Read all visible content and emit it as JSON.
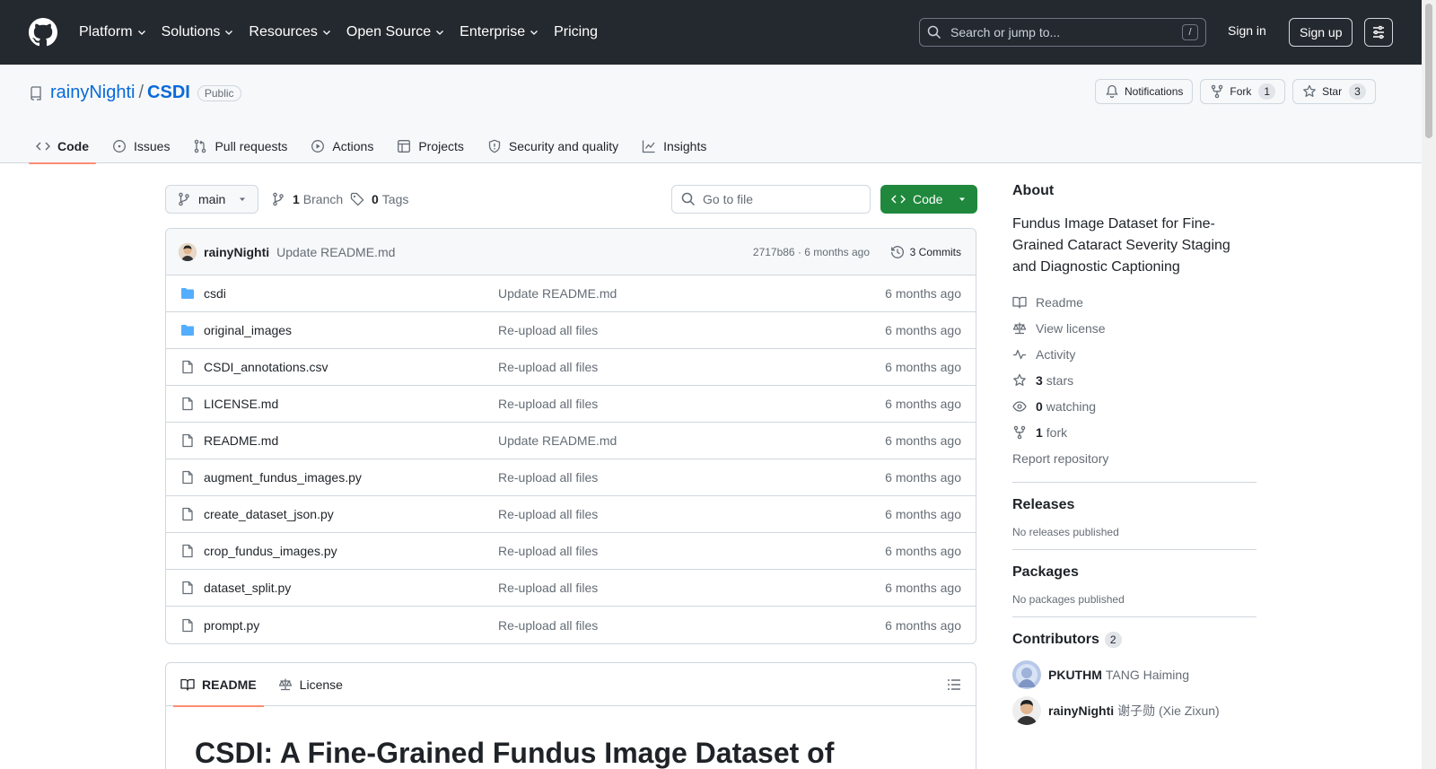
{
  "header": {
    "nav": [
      {
        "label": "Platform",
        "has_dropdown": true
      },
      {
        "label": "Solutions",
        "has_dropdown": true
      },
      {
        "label": "Resources",
        "has_dropdown": true
      },
      {
        "label": "Open Source",
        "has_dropdown": true
      },
      {
        "label": "Enterprise",
        "has_dropdown": true
      },
      {
        "label": "Pricing",
        "has_dropdown": false
      }
    ],
    "search_placeholder": "Search or jump to...",
    "search_shortcut": "/",
    "sign_in": "Sign in",
    "sign_up": "Sign up"
  },
  "repo": {
    "owner": "rainyNighti",
    "separator": "/",
    "name": "CSDI",
    "visibility": "Public",
    "notifications_label": "Notifications",
    "fork_label": "Fork",
    "fork_count": "1",
    "star_label": "Star",
    "star_count": "3",
    "tabs": [
      {
        "label": "Code",
        "icon": "code-icon",
        "active": true
      },
      {
        "label": "Issues",
        "icon": "issue-icon"
      },
      {
        "label": "Pull requests",
        "icon": "pull-request-icon"
      },
      {
        "label": "Actions",
        "icon": "play-icon"
      },
      {
        "label": "Projects",
        "icon": "table-icon"
      },
      {
        "label": "Security and quality",
        "icon": "shield-icon"
      },
      {
        "label": "Insights",
        "icon": "graph-icon"
      }
    ]
  },
  "toolbar": {
    "branch": "main",
    "branch_count": "1",
    "branch_label": "Branch",
    "tag_count": "0",
    "tag_label": "Tags",
    "goto_placeholder": "Go to file",
    "code_button": "Code"
  },
  "commit": {
    "author": "rainyNighti",
    "message": "Update README.md",
    "meta": "2717b86 · 6 months ago",
    "commits_label": "3 Commits"
  },
  "files": [
    {
      "name": "csdi",
      "type": "folder",
      "message": "Update README.md",
      "time": "6 months ago"
    },
    {
      "name": "original_images",
      "type": "folder",
      "message": "Re-upload all files",
      "time": "6 months ago"
    },
    {
      "name": "CSDI_annotations.csv",
      "type": "file",
      "message": "Re-upload all files",
      "time": "6 months ago"
    },
    {
      "name": "LICENSE.md",
      "type": "file",
      "message": "Re-upload all files",
      "time": "6 months ago"
    },
    {
      "name": "README.md",
      "type": "file",
      "message": "Update README.md",
      "time": "6 months ago"
    },
    {
      "name": "augment_fundus_images.py",
      "type": "file",
      "message": "Re-upload all files",
      "time": "6 months ago"
    },
    {
      "name": "create_dataset_json.py",
      "type": "file",
      "message": "Re-upload all files",
      "time": "6 months ago"
    },
    {
      "name": "crop_fundus_images.py",
      "type": "file",
      "message": "Re-upload all files",
      "time": "6 months ago"
    },
    {
      "name": "dataset_split.py",
      "type": "file",
      "message": "Re-upload all files",
      "time": "6 months ago"
    },
    {
      "name": "prompt.py",
      "type": "file",
      "message": "Re-upload all files",
      "time": "6 months ago"
    }
  ],
  "readme": {
    "tab_readme": "README",
    "tab_license": "License",
    "heading": "CSDI: A Fine-Grained Fundus Image Dataset of"
  },
  "about": {
    "title": "About",
    "description": "Fundus Image Dataset for Fine-Grained Cataract Severity Staging and Diagnostic Captioning",
    "readme": "Readme",
    "license": "View license",
    "activity": "Activity",
    "stars_count": "3",
    "stars_label": "stars",
    "watching_count": "0",
    "watching_label": "watching",
    "fork_count": "1",
    "fork_label": "fork",
    "report": "Report repository"
  },
  "releases": {
    "title": "Releases",
    "text": "No releases published"
  },
  "packages": {
    "title": "Packages",
    "text": "No packages published"
  },
  "contributors": {
    "title": "Contributors",
    "count": "2",
    "list": [
      {
        "login": "PKUTHM",
        "name": "TANG Haiming"
      },
      {
        "login": "rainyNighti",
        "name": "谢子勋 (Xie Zixun)"
      }
    ]
  },
  "colors": {
    "header_bg": "#24292f",
    "link": "#0969da",
    "primary_button": "#1f883d",
    "tab_underline": "#fd8c73",
    "folder_icon": "#54aeff"
  }
}
